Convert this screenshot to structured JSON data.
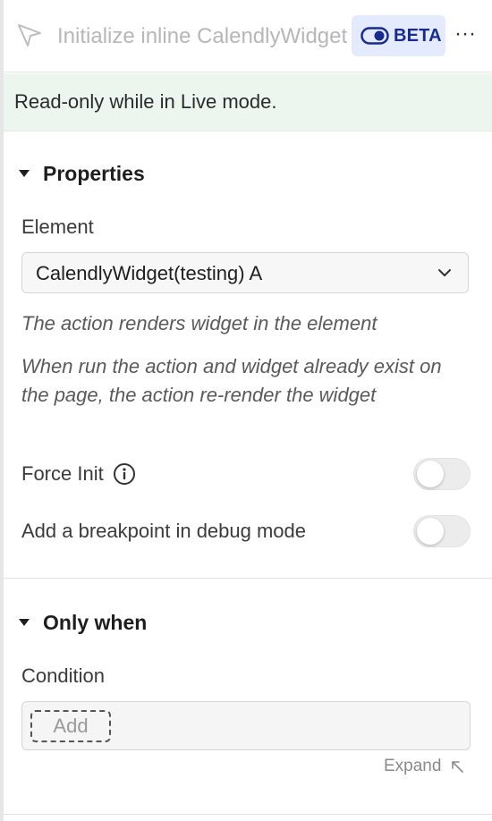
{
  "header": {
    "title": "Initialize inline CalendlyWidget",
    "beta_label": "BETA",
    "more_label": "···",
    "icons": [
      "cursor-icon",
      "toggle-icon",
      "more-icon"
    ]
  },
  "banner": {
    "text": "Read-only while in Live mode."
  },
  "properties": {
    "section_title": "Properties",
    "element_label": "Element",
    "element_value": "CalendlyWidget(testing) A",
    "hint_1": "The action renders widget in the element",
    "hint_2": "When run the action and widget already exist on the page, the action re-render the widget",
    "force_init_label": "Force Init",
    "force_init_on": false,
    "breakpoint_label": "Add a breakpoint in debug mode",
    "breakpoint_on": false
  },
  "only_when": {
    "section_title": "Only when",
    "condition_label": "Condition",
    "add_label": "Add",
    "expand_label": "Expand"
  },
  "colors": {
    "accent": "#1a2b8f",
    "beta_bg": "#e4ebff",
    "banner_bg": "#ecf6ef"
  }
}
